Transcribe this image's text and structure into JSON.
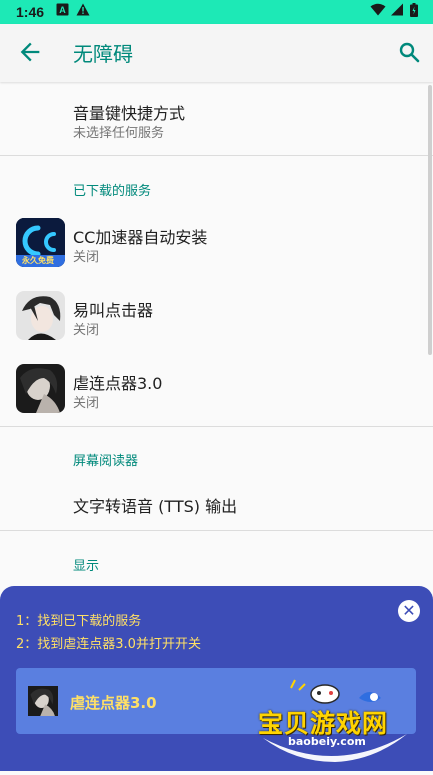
{
  "status_bar": {
    "time": "1:46"
  },
  "app_bar": {
    "title": "无障碍"
  },
  "shortcut": {
    "title": "音量键快捷方式",
    "subtitle": "未选择任何服务"
  },
  "downloaded_section": {
    "header": "已下载的服务"
  },
  "services": [
    {
      "title": "CC加速器自动安装",
      "subtitle": "关闭",
      "icon": "cc-accelerator-icon",
      "icon_badge": "永久免费"
    },
    {
      "title": "易叫点击器",
      "subtitle": "关闭",
      "icon": "anime-avatar-icon"
    },
    {
      "title": "虐连点器3.0",
      "subtitle": "关闭",
      "icon": "dark-avatar-icon"
    }
  ],
  "screen_reader_section": {
    "header": "屏幕阅读器",
    "items": [
      {
        "title": "文字转语音 (TTS) 输出"
      }
    ]
  },
  "display_section": {
    "header": "显示"
  },
  "guide_overlay": {
    "steps": [
      "1：找到已下载的服务",
      "2：找到虐连点器3.0并打开开关"
    ],
    "card_label": "虐连点器3.0"
  },
  "watermark": {
    "text": "宝贝游戏网",
    "url": "baobeiy.com"
  },
  "colors": {
    "accent": "#00897b",
    "status_bar": "#1de9b6",
    "overlay": "#3d4db7",
    "overlay_text": "#ffe066"
  }
}
